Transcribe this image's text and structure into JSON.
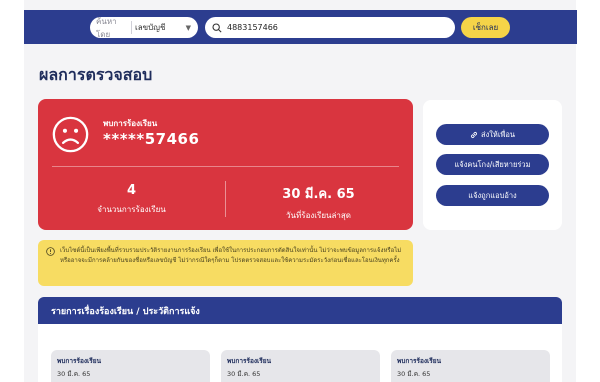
{
  "header": {
    "search_type_label": "ค้นหาโดย",
    "search_type_value": "เลขบัญชี",
    "search_query": "4883157466",
    "check_button": "เช็กเลย"
  },
  "page_title": "ผลการตรวจสอบ",
  "result": {
    "status_label": "พบการร้องเรียน",
    "masked_number": "*****57466",
    "complaint_count": "4",
    "complaint_count_label": "จำนวนการร้องเรียน",
    "last_date": "30 มี.ค. 65",
    "last_date_label": "วันที่ร้องเรียนล่าสุด"
  },
  "actions": {
    "share": "ส่งให้เพื่อน",
    "report_lost": "แจ้งคนโกง/เสียหายร่วม",
    "report_impersonation": "แจ้งถูกแอบอ้าง"
  },
  "notice": "เว็บไซต์นี้เป็นเพียงพื้นที่รวบรวมประวัติรายงานการร้องเรียน เพื่อใช้ในการประกอบการตัดสินใจเท่านั้น ไม่ว่าจะพบข้อมูลการแจ้งหรือไม่ หรืออาจจะมีการคล้ายกันของชื่อหรือเลขบัญชี ไม่ว่ากรณีใดๆก็ตาม โปรดตรวจสอบและใช้ความระมัดระวังก่อนเชื่อและโอนเงินทุกครั้ง",
  "list": {
    "title": "รายการเรื่องร้องเรียน / ประวัติการแจ้ง",
    "items": [
      {
        "title": "พบการร้องเรียน",
        "date": "30 มี.ค. 65"
      },
      {
        "title": "พบการร้องเรียน",
        "date": "30 มี.ค. 65"
      },
      {
        "title": "พบการร้องเรียน",
        "date": "30 มี.ค. 65"
      }
    ]
  },
  "colors": {
    "navy": "#2c3d8f",
    "alert_red": "#d9353f",
    "yellow": "#f5d448"
  }
}
